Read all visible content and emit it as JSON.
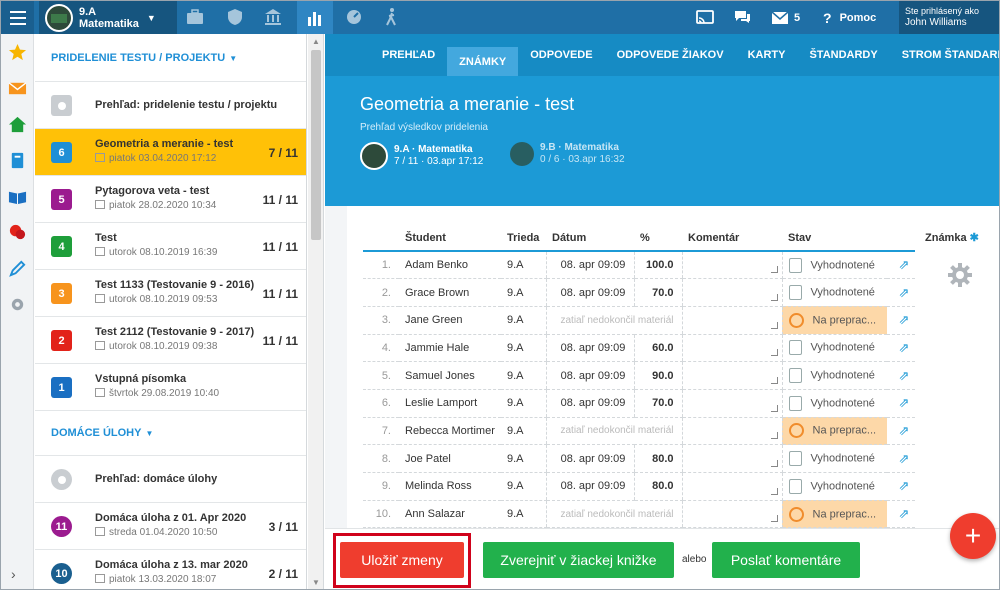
{
  "topbar": {
    "class_name": "9.A",
    "subject": "Matematika",
    "messages_count": "5",
    "help": "Pomoc",
    "logged_as": "Ste prihlásený ako",
    "user": "John Williams"
  },
  "sidebar": {
    "section1_title": "PRIDELENIE TESTU / PROJEKTU",
    "overview1": "Prehľad: pridelenie testu / projektu",
    "tests": [
      {
        "badge": "6",
        "color": "#1f8fd6",
        "title": "Geometria a meranie - test",
        "date": "piatok 03.04.2020 17:12",
        "count": "7 / 11",
        "selected": true
      },
      {
        "badge": "5",
        "color": "#9b1b8f",
        "title": "Pytagorova veta - test",
        "date": "piatok 28.02.2020 10:34",
        "count": "11 / 11"
      },
      {
        "badge": "4",
        "color": "#1e9e3a",
        "title": "Test",
        "date": "utorok 08.10.2019 16:39",
        "count": "11 / 11"
      },
      {
        "badge": "3",
        "color": "#f7941d",
        "title": "Test 1133 (Testovanie 9 - 2016)",
        "date": "utorok 08.10.2019 09:53",
        "count": "11 / 11"
      },
      {
        "badge": "2",
        "color": "#e2231a",
        "title": "Test 2112 (Testovanie 9 - 2017)",
        "date": "utorok 08.10.2019 09:38",
        "count": "11 / 11"
      },
      {
        "badge": "1",
        "color": "#1a6fc2",
        "title": "Vstupná písomka",
        "date": "štvrtok 29.08.2019 10:40",
        "count": ""
      }
    ],
    "section2_title": "DOMÁCE ÚLOHY",
    "overview2": "Prehľad: domáce úlohy",
    "homework": [
      {
        "badge": "11",
        "color": "#9b1b8f",
        "title": "Domáca úloha z 01. Apr 2020",
        "date": "streda 01.04.2020 10:50",
        "count": "3 / 11"
      },
      {
        "badge": "10",
        "color": "#1a5f8f",
        "title": "Domáca úloha z 13. mar 2020",
        "date": "piatok 13.03.2020 18:07",
        "count": "2 / 11"
      }
    ]
  },
  "tabs": [
    "PREHĽAD",
    "ZNÁMKY",
    "ODPOVEDE",
    "ODPOVEDE ŽIAKOV",
    "KARTY",
    "ŠTANDARDY",
    "STROM ŠTANDARDOV"
  ],
  "active_tab": 1,
  "main": {
    "title": "Geometria a meranie - test",
    "subtitle": "Prehľad výsledkov pridelenia",
    "class1_name": "9.A · Matematika",
    "class1_info": "7 / 11 · 03.apr 17:12",
    "class2_name": "9.B · Matematika",
    "class2_info": "0 / 6 · 03.apr 16:32"
  },
  "table": {
    "headers": {
      "student": "Študent",
      "class": "Trieda",
      "date": "Dátum",
      "pct": "%",
      "comment": "Komentár",
      "status": "Stav",
      "grade": "Známka"
    },
    "rows": [
      {
        "n": "1.",
        "name": "Adam Benko",
        "cls": "9.A",
        "date": "08. apr 09:09",
        "pct": "100.0",
        "status": "Vyhodnotené"
      },
      {
        "n": "2.",
        "name": "Grace Brown",
        "cls": "9.A",
        "date": "08. apr 09:09",
        "pct": "70.0",
        "status": "Vyhodnotené"
      },
      {
        "n": "3.",
        "name": "Jane Green",
        "cls": "9.A",
        "pending": "zatiaľ nedokončil materiál",
        "status": "Na preprac...",
        "warn": true
      },
      {
        "n": "4.",
        "name": "Jammie Hale",
        "cls": "9.A",
        "date": "08. apr 09:09",
        "pct": "60.0",
        "status": "Vyhodnotené"
      },
      {
        "n": "5.",
        "name": "Samuel Jones",
        "cls": "9.A",
        "date": "08. apr 09:09",
        "pct": "90.0",
        "status": "Vyhodnotené"
      },
      {
        "n": "6.",
        "name": "Leslie Lamport",
        "cls": "9.A",
        "date": "08. apr 09:09",
        "pct": "70.0",
        "status": "Vyhodnotené"
      },
      {
        "n": "7.",
        "name": "Rebecca Mortimer",
        "cls": "9.A",
        "pending": "zatiaľ nedokončil materiál",
        "status": "Na preprac...",
        "warn": true
      },
      {
        "n": "8.",
        "name": "Joe Patel",
        "cls": "9.A",
        "date": "08. apr 09:09",
        "pct": "80.0",
        "status": "Vyhodnotené"
      },
      {
        "n": "9.",
        "name": "Melinda Ross",
        "cls": "9.A",
        "date": "08. apr 09:09",
        "pct": "80.0",
        "status": "Vyhodnotené"
      },
      {
        "n": "10.",
        "name": "Ann Salazar",
        "cls": "9.A",
        "pending": "zatiaľ nedokončil materiál",
        "status": "Na preprac...",
        "warn": true
      }
    ]
  },
  "footer": {
    "save": "Uložiť zmeny",
    "publish": "Zverejniť v žiackej knižke",
    "or": "alebo",
    "send": "Poslať komentáre"
  },
  "fab": "+"
}
